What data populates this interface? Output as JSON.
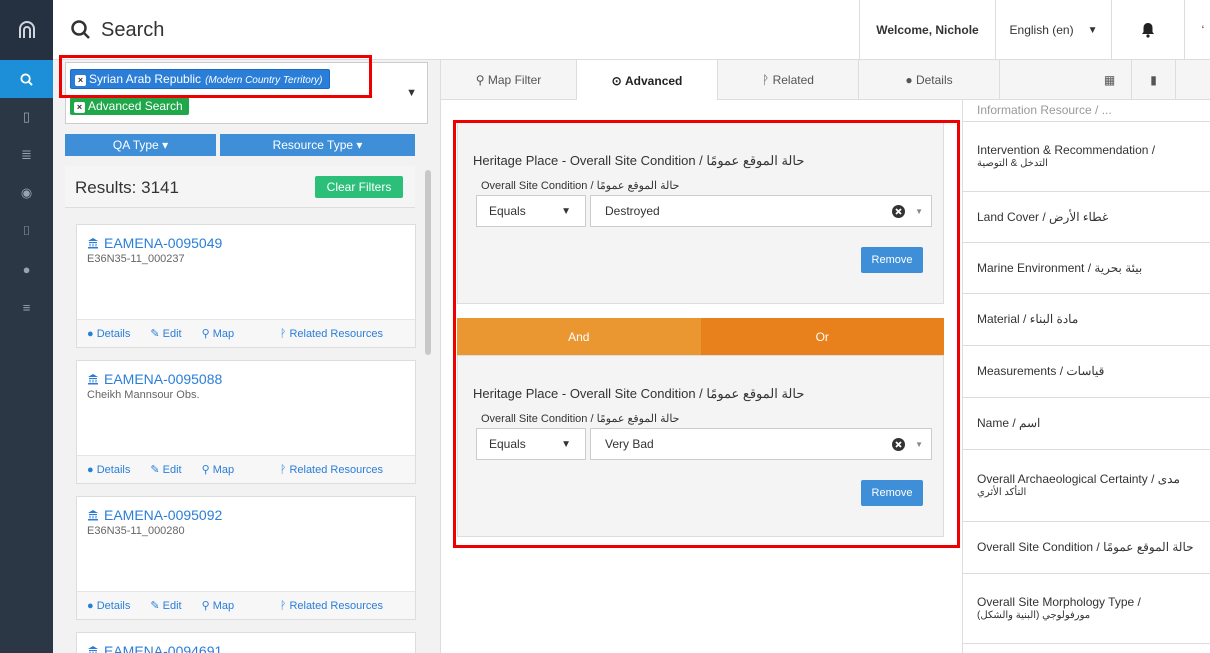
{
  "topbar": {
    "search_label": "Search",
    "welcome": "Welcome, Nichole",
    "language": "English (en)"
  },
  "filters": {
    "country_tag": "Syrian Arab Republic",
    "country_tag_type": "(Modern Country Territory)",
    "advanced_tag": "Advanced Search",
    "qa_type": "QA Type",
    "resource_type": "Resource Type"
  },
  "results": {
    "label": "Results: 3141",
    "clear_filters": "Clear Filters"
  },
  "cards": [
    {
      "id": "EAMENA-0095049",
      "sub": "E36N35-11_000237"
    },
    {
      "id": "EAMENA-0095088",
      "sub": "Cheikh Mannsour Obs."
    },
    {
      "id": "EAMENA-0095092",
      "sub": "E36N35-11_000280"
    },
    {
      "id": "EAMENA-0094691",
      "sub": ""
    }
  ],
  "card_actions": {
    "details": "Details",
    "edit": "Edit",
    "map": "Map",
    "related": "Related Resources"
  },
  "tabs": {
    "map_filter": "Map Filter",
    "advanced": "Advanced",
    "related": "Related",
    "details": "Details"
  },
  "criteria": [
    {
      "title": "Heritage Place - Overall Site Condition / حالة الموقع عمومًا",
      "field_label": "Overall Site Condition / حالة الموقع عمومًا",
      "operator": "Equals",
      "value": "Destroyed",
      "remove": "Remove"
    },
    {
      "title": "Heritage Place - Overall Site Condition / حالة الموقع عمومًا",
      "field_label": "Overall Site Condition / حالة الموقع عمومًا",
      "operator": "Equals",
      "value": "Very Bad",
      "remove": "Remove"
    }
  ],
  "andor": {
    "and": "And",
    "or": "Or"
  },
  "right_list": [
    {
      "label": "Information Resource / ...",
      "sub": ""
    },
    {
      "label": "Intervention & Recommendation /",
      "sub": "التدخل & التوصية"
    },
    {
      "label": "Land Cover / غطاء الأرض",
      "sub": ""
    },
    {
      "label": "Marine Environment / بيئة بحرية",
      "sub": ""
    },
    {
      "label": "Material / مادة البناء",
      "sub": ""
    },
    {
      "label": "Measurements / قياسات",
      "sub": ""
    },
    {
      "label": "Name / اسم",
      "sub": ""
    },
    {
      "label": "Overall Archaeological Certainty / مدى",
      "sub": "التأكد الأثري"
    },
    {
      "label": "Overall Site Condition / حالة الموقع عمومًا",
      "sub": ""
    },
    {
      "label": "Overall Site Morphology Type /",
      "sub": "مورفولوجي (البنية والشكل)"
    }
  ],
  "colors": {
    "rail": "#2b3744",
    "accent_blue": "#2a7ed8",
    "green": "#1fa74a",
    "and_orange": "#ea9732",
    "or_orange": "#e8811c",
    "highlight_red": "#e00000"
  }
}
